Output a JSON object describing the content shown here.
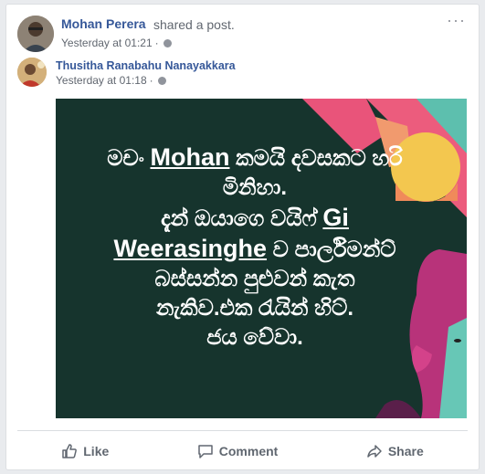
{
  "post": {
    "sharer_name": "Mohan Perera",
    "shared_text": "shared a post.",
    "sharer_time": "Yesterday at 01:21",
    "author_name": "Thusitha Ranabahu Nanayakkara",
    "author_time": "Yesterday at 01:18",
    "separator": "·",
    "more_label": "···"
  },
  "image_text": {
    "l1_pre": "මචං ",
    "l1_name": "Mohan",
    "l1_post": " කමයි දවසකට හරි",
    "l2": "මිනිහා.",
    "l3_pre": "දැන් ඔයාගෙ වයිෆ් ",
    "l3_name": "Gi",
    "l4_name": "Weerasinghe",
    "l4_post": " ව පාර්ලිමන්ට්",
    "l5": "බස්සන්න පුළුවන් කැත",
    "l6": "නැකිව.එක රැයින් හිට්.",
    "l7": "ජය වේවා."
  },
  "actions": {
    "like": "Like",
    "comment": "Comment",
    "share": "Share"
  },
  "colors": {
    "link": "#365899",
    "image_bg": "#16342d",
    "pink": "#ec5c7d",
    "magenta": "#b8337a",
    "yellow": "#f3c74f",
    "teal": "#67c7b6"
  },
  "icons": [
    "more-options-icon",
    "globe-icon",
    "like-icon",
    "comment-icon",
    "share-icon"
  ]
}
